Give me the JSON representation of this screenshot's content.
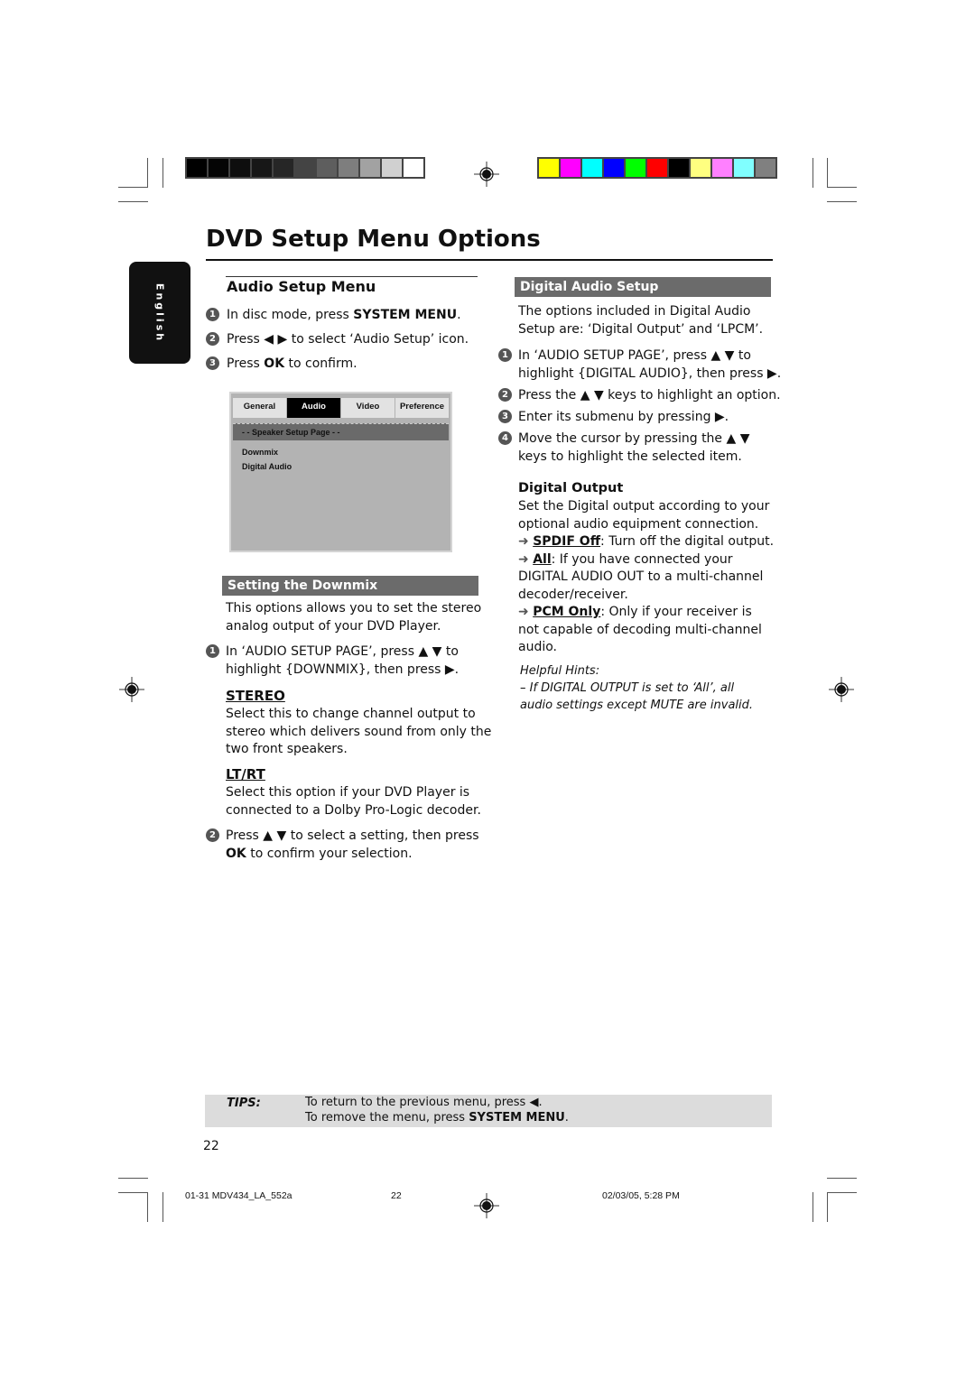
{
  "print_marks": {
    "gray_swatches": [
      "#000000",
      "#050505",
      "#0e0e0e",
      "#171717",
      "#262626",
      "#444444",
      "#5e5e5e",
      "#7e7e7e",
      "#a2a2a2",
      "#d0d0d0",
      "#ffffff"
    ],
    "color_swatches": [
      "#ffff00",
      "#ff00ff",
      "#00ffff",
      "#0000ff",
      "#00ff00",
      "#ff0000",
      "#000000",
      "#ffff80",
      "#ff80ff",
      "#80ffff",
      "#808080"
    ]
  },
  "page": {
    "title": "DVD Setup Menu Options",
    "language_tab": "English",
    "page_number": "22"
  },
  "audio_setup_menu": {
    "heading": "Audio Setup Menu",
    "steps": [
      {
        "num": "1",
        "pre": "In disc mode, press ",
        "bold": "SYSTEM MENU",
        "post": "."
      },
      {
        "num": "2",
        "pre": "Press ◀ ▶ to select ‘Audio Setup’ icon.",
        "bold": "",
        "post": ""
      },
      {
        "num": "3",
        "pre": "Press ",
        "bold": "OK",
        "post": " to confirm."
      }
    ]
  },
  "osd_menu": {
    "tabs": [
      "General",
      "Audio",
      "Video",
      "Preference"
    ],
    "active_tab": "Audio",
    "page_label": "- -   Speaker Setup Page   - -",
    "items": [
      "Downmix",
      "Digital Audio"
    ]
  },
  "downmix": {
    "heading": "Setting the Downmix",
    "intro_1": "This options allows you to set the stereo",
    "intro_2": "analog output of your DVD Player.",
    "step1_num": "1",
    "step1_line1": "In ‘AUDIO SETUP PAGE’, press ▲ ▼ to",
    "step1_line2": "highlight {DOWNMIX}, then press ▶.",
    "stereo_title": "STEREO",
    "stereo_lines": [
      "Select this to change channel output to",
      "stereo which delivers sound from only the",
      "two front speakers."
    ],
    "ltrt_title": "LT/RT",
    "ltrt_lines": [
      "Select this option if your DVD Player is",
      "connected to a Dolby Pro-Logic decoder."
    ],
    "step2_num": "2",
    "step2_line1": "Press ▲ ▼ to select a setting, then press",
    "step2_bold": "OK",
    "step2_line2_post": " to confirm your selection."
  },
  "digital_audio": {
    "heading": "Digital Audio Setup",
    "intro_1": "The options included in Digital Audio",
    "intro_2": "Setup are: ‘Digital Output’ and ‘LPCM’.",
    "steps": [
      {
        "num": "1",
        "lines": [
          "In ‘AUDIO SETUP PAGE’, press ▲ ▼ to",
          "highlight {DIGITAL AUDIO}, then press ▶."
        ]
      },
      {
        "num": "2",
        "lines": [
          "Press the ▲ ▼ keys to highlight an option."
        ]
      },
      {
        "num": "3",
        "lines": [
          "Enter its submenu by pressing ▶."
        ]
      },
      {
        "num": "4",
        "lines": [
          "Move the cursor by pressing the ▲ ▼",
          "keys to highlight the selected item."
        ]
      }
    ],
    "output_heading": "Digital Output",
    "output_intro_1": "Set the Digital output according to your",
    "output_intro_2": "optional audio equipment connection.",
    "arrow": "➜",
    "opt1_name": "SPDIF Off",
    "opt1_desc": ": Turn off the digital output.",
    "opt2_name": "All",
    "opt2_desc_1": ": If you have connected your",
    "opt2_desc_2": "DIGITAL AUDIO OUT to a multi-channel",
    "opt2_desc_3": "decoder/receiver.",
    "opt3_name": "PCM Only",
    "opt3_desc_1": ": Only if your receiver is",
    "opt3_desc_2": "not capable of decoding multi-channel",
    "opt3_desc_3": "audio.",
    "hints_title": "Helpful Hints:",
    "hints_line1": "–    If DIGITAL OUTPUT is set to ‘All’, all",
    "hints_line2": "audio settings except MUTE are invalid."
  },
  "tips": {
    "label": "TIPS:",
    "line1": "To return to the previous menu, press ◀.",
    "line2_pre": "To remove the menu, press ",
    "line2_bold": "SYSTEM MENU",
    "line2_post": "."
  },
  "footer": {
    "file": "01-31 MDV434_LA_552a",
    "page": "22",
    "date": "02/03/05, 5:28 PM"
  }
}
